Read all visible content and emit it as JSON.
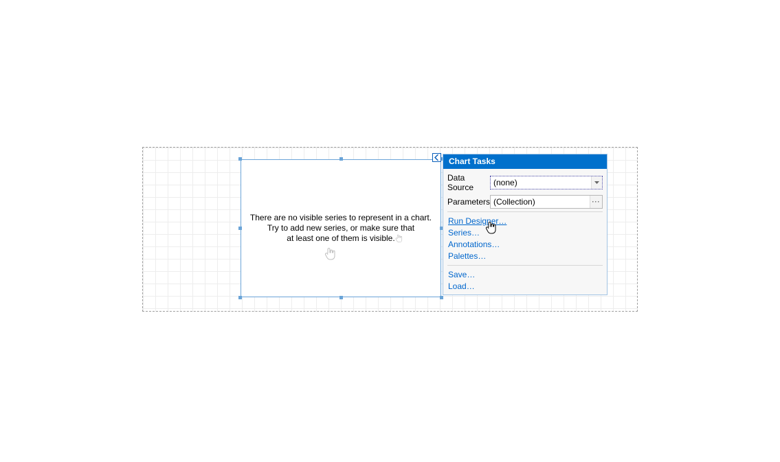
{
  "chart_placeholder": {
    "line1": "There are no visible series to represent in a chart.",
    "line2": "Try to add new series, or make sure that",
    "line3": "at least one of them is visible."
  },
  "tasks": {
    "title": "Chart Tasks",
    "props": {
      "data_source": {
        "label": "Data Source",
        "value": "(none)"
      },
      "parameters": {
        "label": "Parameters",
        "value": "(Collection)"
      }
    },
    "actions": {
      "run_designer": "Run Designer…",
      "series": "Series…",
      "annotations": "Annotations…",
      "palettes": "Palettes…",
      "save": "Save…",
      "load": "Load…"
    }
  }
}
